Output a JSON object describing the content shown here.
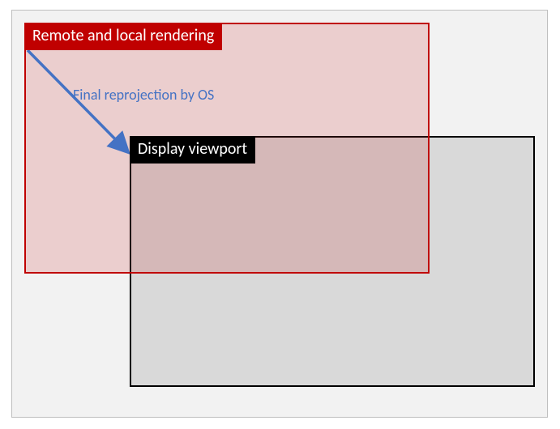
{
  "diagram": {
    "rendering_label": "Remote and local rendering",
    "viewport_label": "Display viewport",
    "arrow_caption": "Final reprojection by OS",
    "colors": {
      "rendering_border": "#c00000",
      "rendering_fill": "rgba(192,0,0,0.15)",
      "viewport_border": "#000000",
      "viewport_fill": "rgba(0,0,0,0.10)",
      "arrow": "#4472c4",
      "outer_bg": "#f2f2f2",
      "outer_border": "#bfbfbf"
    }
  }
}
